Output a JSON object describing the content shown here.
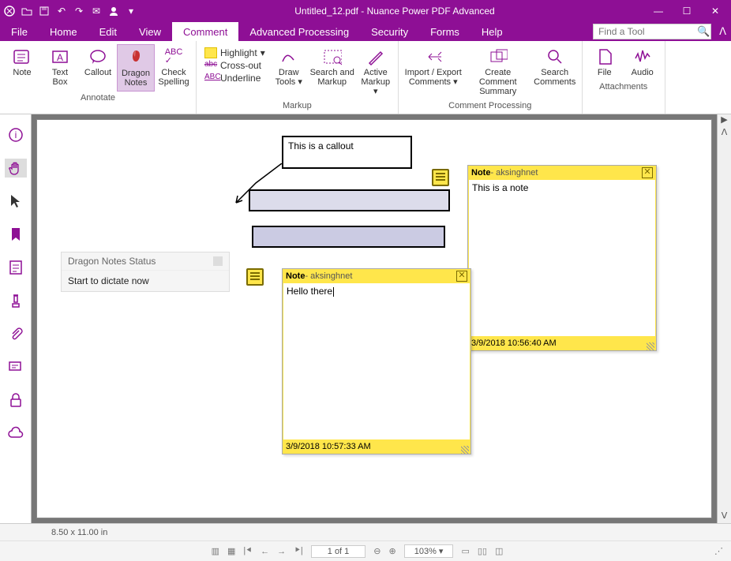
{
  "title": "Untitled_12.pdf - Nuance Power PDF Advanced",
  "menu": {
    "file": "File",
    "home": "Home",
    "edit": "Edit",
    "view": "View",
    "comment": "Comment",
    "adv": "Advanced Processing",
    "security": "Security",
    "forms": "Forms",
    "help": "Help"
  },
  "search": {
    "placeholder": "Find a Tool"
  },
  "ribbon": {
    "note": "Note",
    "textbox": "Text\nBox",
    "callout": "Callout",
    "dragon": "Dragon\nNotes",
    "spelling": "Check\nSpelling",
    "highlight": "Highlight",
    "crossout": "Cross-out",
    "underline": "Underline",
    "drawtools": "Draw\nTools",
    "searchmarkup": "Search and\nMarkup",
    "activemarkup": "Active\nMarkup",
    "importexport": "Import / Export\nComments",
    "createsummary": "Create Comment\nSummary",
    "searchcomments": "Search\nComments",
    "file": "File",
    "audio": "Audio",
    "grp_annotate": "Annotate",
    "grp_markup": "Markup",
    "grp_commentproc": "Comment Processing",
    "grp_attach": "Attachments"
  },
  "canvas": {
    "callout_text": "This is a callout",
    "dragon_header": "Dragon Notes Status",
    "dragon_body": "Start to dictate now"
  },
  "note1": {
    "title": "Note",
    "author": " - aksinghnet",
    "text": "This is a note",
    "time": "3/9/2018 10:56:40 AM"
  },
  "note2": {
    "title": "Note",
    "author": " - aksinghnet",
    "text": "Hello there",
    "time": "3/9/2018 10:57:33 AM"
  },
  "status": {
    "dim": "8.50 x 11.00 in",
    "page": "1 of 1",
    "zoom": "103%"
  }
}
